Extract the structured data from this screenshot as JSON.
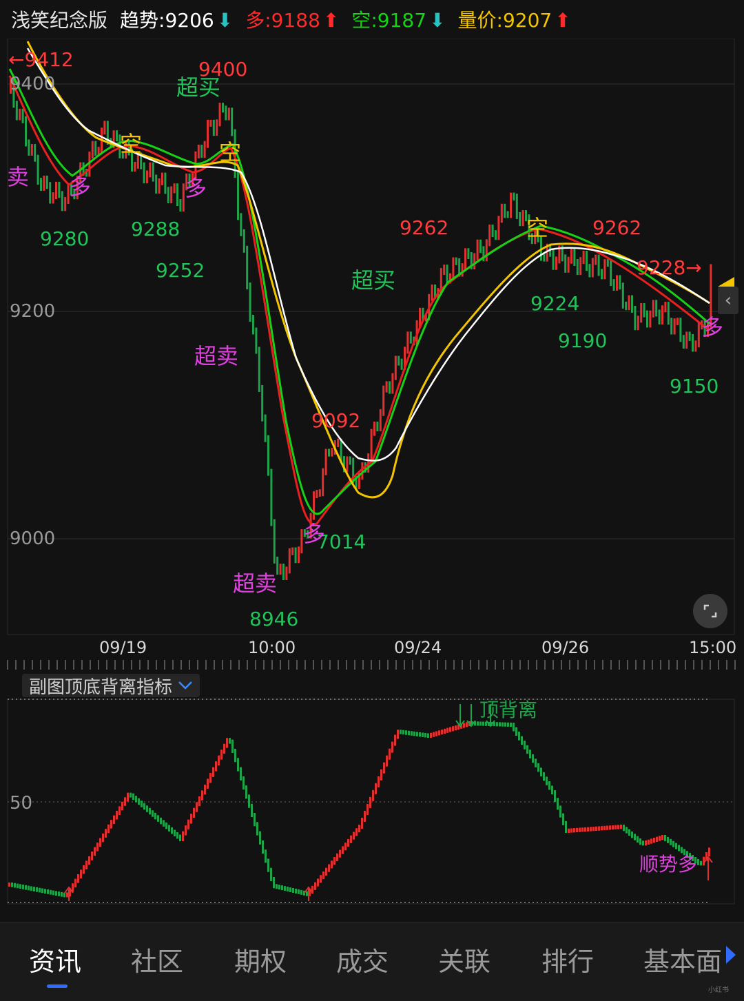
{
  "header": {
    "title": "浅笑纪念版",
    "trend": {
      "label": "趋势:9206",
      "color": "#ffffff",
      "arrow": "⬇"
    },
    "long": {
      "label": "多:9188",
      "color": "#ff2a2a",
      "arrow": "⬆"
    },
    "short": {
      "label": "空:9187",
      "color": "#16d316",
      "arrow": "⬇"
    },
    "volume_price": {
      "label": "量价:9207",
      "color": "#f2c500",
      "arrow": "⬆"
    }
  },
  "price_axis": [
    "9400",
    "9200",
    "9000"
  ],
  "price_labels": {
    "hi_9412": "←9412",
    "p9400": "9400",
    "p9280": "9280",
    "p9288": "9288",
    "p9252": "9252",
    "p9262a": "9262",
    "p9262b": "9262",
    "p9224": "9224",
    "p9190": "9190",
    "p9228": "9228→",
    "p9150": "9150",
    "p9092": "9092",
    "p9014": "7014",
    "p8946": "8946"
  },
  "signals": {
    "sell": "卖",
    "overbought": "超买",
    "oversold": "超卖",
    "empty": "空",
    "long": "多"
  },
  "time_axis": [
    "09/19",
    "10:00",
    "09/24",
    "09/26",
    "15:00"
  ],
  "indicator": {
    "name": "副图顶底背离指标",
    "axis_value": "50",
    "top_divergence": "顶背离",
    "trend_long": "顺势多"
  },
  "tabs": [
    {
      "label": "资讯",
      "active": true
    },
    {
      "label": "社区",
      "active": false
    },
    {
      "label": "期权",
      "active": false
    },
    {
      "label": "成交",
      "active": false
    },
    {
      "label": "关联",
      "active": false
    },
    {
      "label": "排行",
      "active": false
    },
    {
      "label": "基本面",
      "active": false
    }
  ],
  "watermark": "小红书",
  "colors": {
    "up": "#e03030",
    "down": "#1fa24a",
    "yellow": "#f2c500",
    "white": "#ffffff",
    "magenta": "#e040e0",
    "green_text": "#23c25a",
    "red_text": "#ff3b3b"
  }
}
